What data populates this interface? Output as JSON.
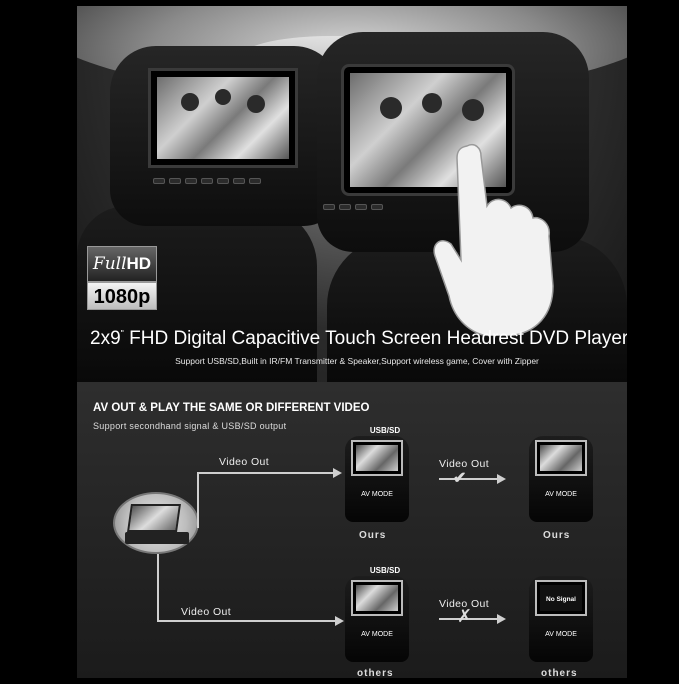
{
  "hero": {
    "badge_top_italic": "Full",
    "badge_top_bold": "HD",
    "badge_bottom": "1080p",
    "title_prefix": "2x9",
    "title_unit": "\"",
    "title_rest": " FHD Digital Capacitive Touch Screen Headrest DVD Player",
    "subtitle": "Support USB/SD,Built in IR/FM Transmitter & Speaker,Support wireless game, Cover with Zipper",
    "left_buttons": [
      "",
      "",
      "",
      "",
      "",
      "",
      ""
    ],
    "right_buttons": [
      "",
      "",
      "",
      ""
    ]
  },
  "section": {
    "title": "AV OUT & PLAY THE SAME OR DIFFERENT VIDEO",
    "subtitle": "Support secondhand signal & USB/SD output",
    "top_path_label": "Video Out",
    "bottom_path_label": "Video Out",
    "ours": {
      "source_tag": "USB/SD",
      "left_mode": "AV MODE",
      "left_caption": "Ours",
      "link_label": "Video Out",
      "right_mode": "AV MODE",
      "right_caption": "Ours"
    },
    "others": {
      "source_tag": "USB/SD",
      "left_mode": "AV MODE",
      "left_caption": "others",
      "link_label": "Video Out",
      "right_screen_text": "No Signal",
      "right_mode": "AV MODE",
      "right_caption": "others"
    }
  },
  "colors": {
    "page_background": "#000000",
    "section_background": "#2e2e2e",
    "text": "#ffffff"
  },
  "icons": [
    "checkmark-icon",
    "cross-icon",
    "arrow-right-icon"
  ]
}
